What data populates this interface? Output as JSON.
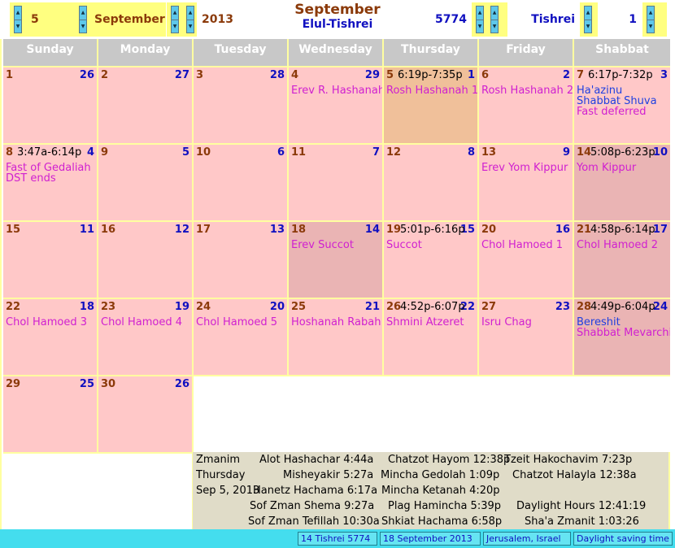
{
  "toolbar": {
    "gregorian_day": "5",
    "gregorian_month": "September",
    "gregorian_year": "2013",
    "title_month": "September",
    "title_hebrew_months": "Elul-Tishrei",
    "hebrew_year": "5774",
    "hebrew_month": "Tishrei",
    "hebrew_day": "1"
  },
  "weekdays": [
    "Sunday",
    "Monday",
    "Tuesday",
    "Wednesday",
    "Thursday",
    "Friday",
    "Shabbat"
  ],
  "weeks": [
    [
      {
        "g": "1",
        "h": "26",
        "time": "",
        "events": []
      },
      {
        "g": "2",
        "h": "27",
        "time": "",
        "events": []
      },
      {
        "g": "3",
        "h": "28",
        "time": "",
        "events": []
      },
      {
        "g": "4",
        "h": "29",
        "time": "",
        "events": [
          {
            "text": "Erev R. Hashanah",
            "color": "mag"
          }
        ]
      },
      {
        "g": "5",
        "h": "1",
        "time": "6:19p-7:35p",
        "events": [
          {
            "text": "Rosh Hashanah 1",
            "color": "mag"
          }
        ],
        "style": "today"
      },
      {
        "g": "6",
        "h": "2",
        "time": "",
        "events": [
          {
            "text": "Rosh Hashanah 2",
            "color": "mag"
          }
        ]
      },
      {
        "g": "7",
        "h": "3",
        "time": "6:17p-7:32p",
        "events": [
          {
            "text": "Ha'azinu",
            "color": "blue"
          },
          {
            "text": "Shabbat Shuva",
            "color": "blue"
          },
          {
            "text": "Fast deferred",
            "color": "mag"
          }
        ]
      }
    ],
    [
      {
        "g": "8",
        "h": "4",
        "time": "3:47a-6:14p",
        "events": [
          {
            "text": "Fast of Gedaliah",
            "color": "mag"
          },
          {
            "text": "DST ends",
            "color": "mag"
          }
        ]
      },
      {
        "g": "9",
        "h": "5",
        "time": "",
        "events": []
      },
      {
        "g": "10",
        "h": "6",
        "time": "",
        "events": []
      },
      {
        "g": "11",
        "h": "7",
        "time": "",
        "events": []
      },
      {
        "g": "12",
        "h": "8",
        "time": "",
        "events": []
      },
      {
        "g": "13",
        "h": "9",
        "time": "",
        "events": [
          {
            "text": "Erev Yom Kippur",
            "color": "mag"
          }
        ]
      },
      {
        "g": "14",
        "h": "10",
        "time": "5:08p-6:23p",
        "events": [
          {
            "text": "Yom Kippur",
            "color": "mag"
          }
        ],
        "style": "mid"
      }
    ],
    [
      {
        "g": "15",
        "h": "11",
        "time": "",
        "events": []
      },
      {
        "g": "16",
        "h": "12",
        "time": "",
        "events": []
      },
      {
        "g": "17",
        "h": "13",
        "time": "",
        "events": []
      },
      {
        "g": "18",
        "h": "14",
        "time": "",
        "events": [
          {
            "text": "Erev Succot",
            "color": "mag"
          }
        ],
        "style": "mid"
      },
      {
        "g": "19",
        "h": "15",
        "time": "5:01p-6:16p",
        "events": [
          {
            "text": "Succot",
            "color": "mag"
          }
        ]
      },
      {
        "g": "20",
        "h": "16",
        "time": "",
        "events": [
          {
            "text": "Chol Hamoed 1",
            "color": "mag"
          }
        ]
      },
      {
        "g": "21",
        "h": "17",
        "time": "4:58p-6:14p",
        "events": [
          {
            "text": "Chol Hamoed 2",
            "color": "mag"
          }
        ],
        "style": "mid"
      }
    ],
    [
      {
        "g": "22",
        "h": "18",
        "time": "",
        "events": [
          {
            "text": "Chol Hamoed 3",
            "color": "mag"
          }
        ]
      },
      {
        "g": "23",
        "h": "19",
        "time": "",
        "events": [
          {
            "text": "Chol Hamoed 4",
            "color": "mag"
          }
        ]
      },
      {
        "g": "24",
        "h": "20",
        "time": "",
        "events": [
          {
            "text": "Chol Hamoed 5",
            "color": "mag"
          }
        ]
      },
      {
        "g": "25",
        "h": "21",
        "time": "",
        "events": [
          {
            "text": "Hoshanah Rabah",
            "color": "mag"
          }
        ]
      },
      {
        "g": "26",
        "h": "22",
        "time": "4:52p-6:07p",
        "events": [
          {
            "text": "Shmini Atzeret",
            "color": "mag"
          }
        ]
      },
      {
        "g": "27",
        "h": "23",
        "time": "",
        "events": [
          {
            "text": "Isru Chag",
            "color": "mag"
          }
        ]
      },
      {
        "g": "28",
        "h": "24",
        "time": "4:49p-6:04p",
        "events": [
          {
            "text": "Bereshit",
            "color": "blue"
          },
          {
            "text": "Shabbat Mevarchim",
            "color": "mag"
          }
        ],
        "style": "mid"
      }
    ],
    [
      {
        "g": "29",
        "h": "25",
        "time": "",
        "events": []
      },
      {
        "g": "30",
        "h": "26",
        "time": "",
        "events": []
      }
    ]
  ],
  "zmanim": {
    "heading": "Zmanim",
    "day": "Thursday",
    "date": "Sep  5, 2013",
    "alot": "Alot Hashachar 4:44a",
    "misheyakir": "Misheyakir 5:27a",
    "hanetz": "Hanetz Hachama 6:17a",
    "shema": "Sof Zman Shema 9:27a",
    "tefillah": "Sof Zman Tefillah 10:30a",
    "chatzot_hayom": "Chatzot Hayom 12:38p",
    "mincha_gedolah": "Mincha Gedolah 1:09p",
    "mincha_ketanah": "Mincha Ketanah 4:20p",
    "plag": "Plag Haminchа 5:39p",
    "shkiat": "Shkiat Hachama 6:58p",
    "tzeit": "Tzeit Hakochavim 7:23p",
    "chatzot_halayla": "Chatzot Halayla 12:38a",
    "daylight": "Daylight Hours 12:41:19",
    "shaa": "Sha'a Zmanit  1:03:26"
  },
  "status": {
    "hebrew_date": "14 Tishrei 5774",
    "gregorian_date": "18 September 2013",
    "location": "Jerusalem, Israel",
    "dst": "Daylight saving time"
  }
}
